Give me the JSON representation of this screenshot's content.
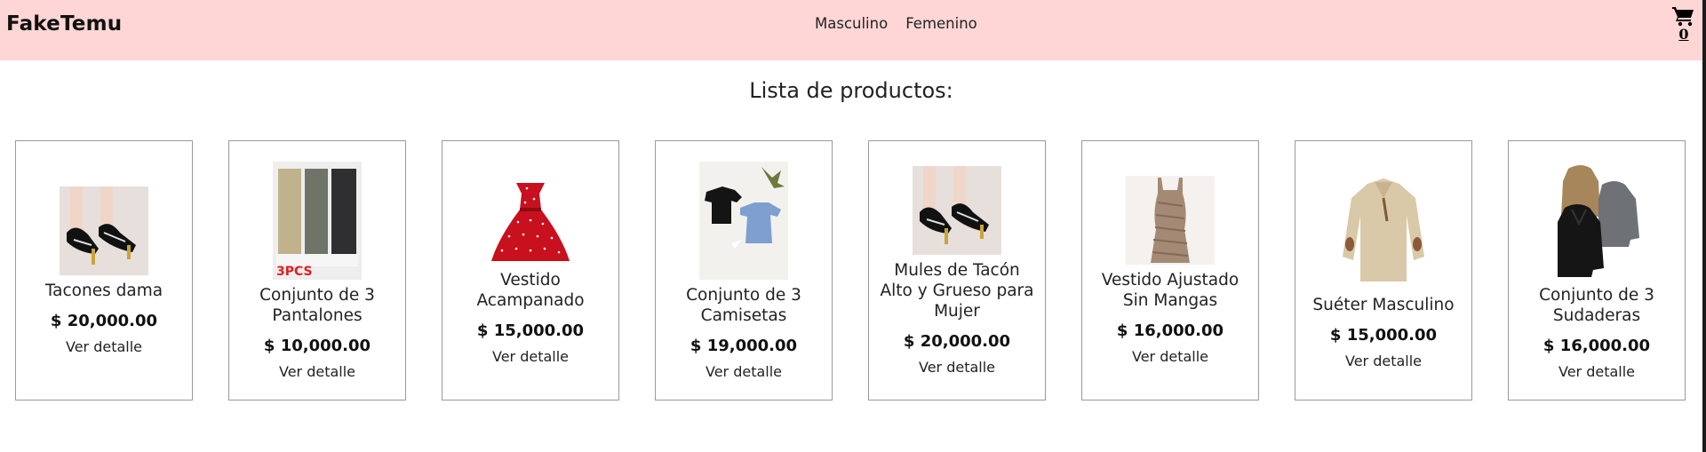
{
  "header": {
    "brand": "FakeTemu",
    "nav": [
      {
        "label": "Masculino"
      },
      {
        "label": "Femenino"
      }
    ],
    "cart": {
      "icon": "cart-icon",
      "count": "0"
    }
  },
  "page": {
    "heading": "Lista de productos:",
    "detail_label": "Ver detalle"
  },
  "products": [
    {
      "name": "Tacones dama",
      "price": "$ 20,000.00",
      "image": "black-heels-image",
      "detail": "Ver detalle"
    },
    {
      "name": "Conjunto de 3 Pantalones",
      "price": "$ 10,000.00",
      "image": "three-pants-image",
      "image_text": "3PCS",
      "detail": "Ver detalle"
    },
    {
      "name": "Vestido Acampanado",
      "price": "$ 15,000.00",
      "image": "polka-dot-dress-image",
      "detail": "Ver detalle"
    },
    {
      "name": "Conjunto de 3 Camisetas",
      "price": "$ 19,000.00",
      "image": "three-tshirts-image",
      "detail": "Ver detalle"
    },
    {
      "name": "Mules de Tacón Alto y Grueso para Mujer",
      "price": "$ 20,000.00",
      "image": "black-mules-image",
      "detail": "Ver detalle"
    },
    {
      "name": "Vestido Ajustado Sin Mangas",
      "price": "$ 16,000.00",
      "image": "fitted-dress-image",
      "detail": "Ver detalle"
    },
    {
      "name": "Suéter Masculino",
      "price": "$ 15,000.00",
      "image": "beige-sweater-image",
      "detail": "Ver detalle"
    },
    {
      "name": "Conjunto de 3 Sudaderas",
      "price": "$ 16,000.00",
      "image": "three-hoodies-image",
      "detail": "Ver detalle"
    }
  ],
  "colors": {
    "navbar_bg": "#ffd6d6",
    "text": "#222222",
    "card_border": "#9a9a9a"
  }
}
